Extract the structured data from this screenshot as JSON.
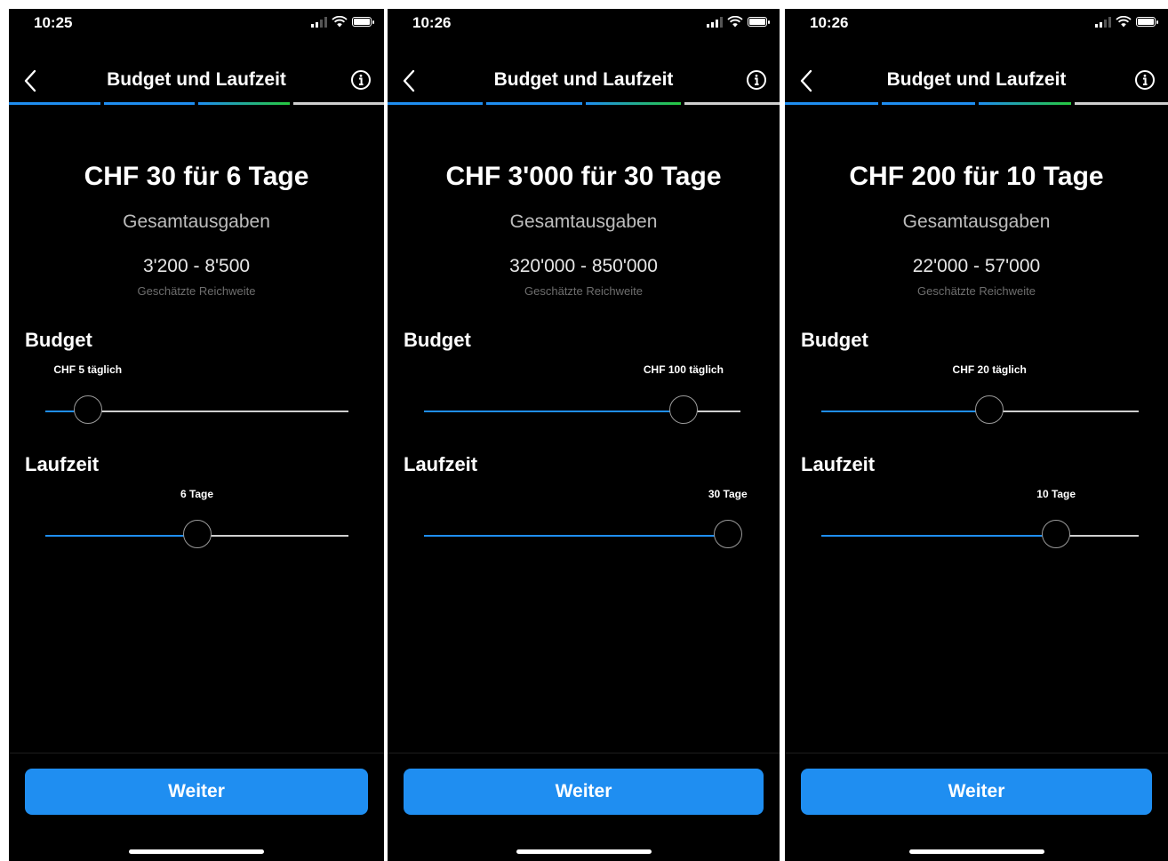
{
  "colors": {
    "background": "#000000",
    "accent": "#1f8ef1",
    "progress_green": "#27c93f",
    "track": "#cfcfcf"
  },
  "screens": [
    {
      "time": "10:25",
      "title": "Budget und Laufzeit",
      "headline": "CHF 30 für 6 Tage",
      "subtitle": "Gesamtausgaben",
      "reach": "3'200 - 8'500",
      "reach_label": "Geschätzte Reichweite",
      "budget_label": "Budget",
      "budget_value": "CHF 5 täglich",
      "budget_position": 0.14,
      "laufzeit_label": "Laufzeit",
      "laufzeit_value": "6 Tage",
      "laufzeit_position": 0.5,
      "button": "Weiter"
    },
    {
      "time": "10:26",
      "title": "Budget und Laufzeit",
      "headline": "CHF 3'000 für 30 Tage",
      "subtitle": "Gesamtausgaben",
      "reach": "320'000 - 850'000",
      "reach_label": "Geschätzte Reichweite",
      "budget_label": "Budget",
      "budget_value": "CHF 100 täglich",
      "budget_position": 0.82,
      "laufzeit_label": "Laufzeit",
      "laufzeit_value": "30 Tage",
      "laufzeit_position": 0.96,
      "button": "Weiter"
    },
    {
      "time": "10:26",
      "title": "Budget und Laufzeit",
      "headline": "CHF 200 für 10 Tage",
      "subtitle": "Gesamtausgaben",
      "reach": "22'000 - 57'000",
      "reach_label": "Geschätzte Reichweite",
      "budget_label": "Budget",
      "budget_value": "CHF 20 täglich",
      "budget_position": 0.53,
      "laufzeit_label": "Laufzeit",
      "laufzeit_value": "10 Tage",
      "laufzeit_position": 0.74,
      "button": "Weiter"
    }
  ]
}
